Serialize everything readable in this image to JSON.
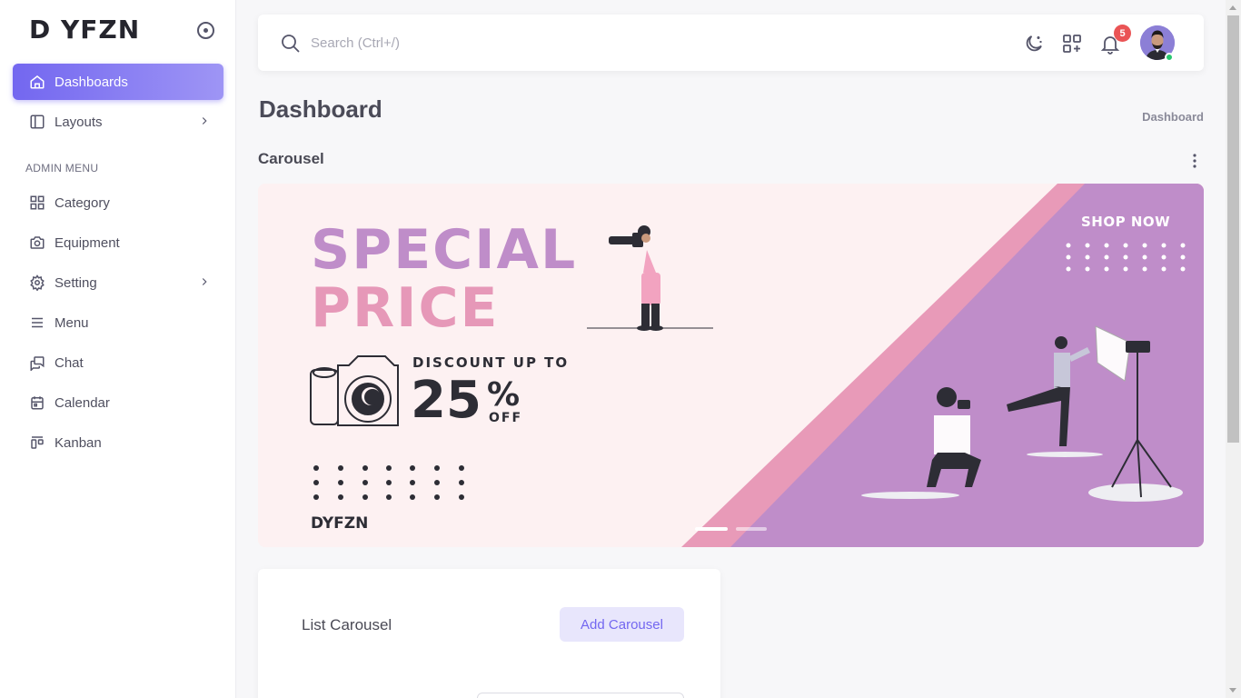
{
  "brand": {
    "name": "D YFZN"
  },
  "sidebar": {
    "items": [
      {
        "label": "Dashboards",
        "icon": "home-icon",
        "active": true
      },
      {
        "label": "Layouts",
        "icon": "layout-icon",
        "has_submenu": true
      }
    ],
    "section_label": "ADMIN MENU",
    "admin_items": [
      {
        "label": "Category",
        "icon": "grid-icon"
      },
      {
        "label": "Equipment",
        "icon": "camera-icon"
      },
      {
        "label": "Setting",
        "icon": "gear-icon",
        "has_submenu": true
      },
      {
        "label": "Menu",
        "icon": "menu-icon"
      },
      {
        "label": "Chat",
        "icon": "chat-icon"
      },
      {
        "label": "Calendar",
        "icon": "calendar-icon"
      },
      {
        "label": "Kanban",
        "icon": "kanban-icon"
      }
    ]
  },
  "header": {
    "search_placeholder": "Search (Ctrl+/)",
    "notification_count": "5"
  },
  "page": {
    "title": "Dashboard",
    "breadcrumb": "Dashboard",
    "section_title": "Carousel"
  },
  "carousel": {
    "slides_total": 2,
    "active_slide": 1,
    "banner": {
      "line1": "SPECIAL",
      "line2": "PRICE",
      "discount_label": "DISCOUNT UP TO",
      "discount_value": "25",
      "discount_sign": "%",
      "off": "OFF",
      "logo": "DYFZN",
      "cta": "SHOP NOW"
    }
  },
  "list": {
    "title": "List Carousel",
    "add_button": "Add Carousel"
  },
  "colors": {
    "accent": "#7367f0",
    "banner_purple": "#bf8dc9",
    "banner_pink": "#e698b8",
    "notification": "#ea5455",
    "online": "#28c76f"
  }
}
